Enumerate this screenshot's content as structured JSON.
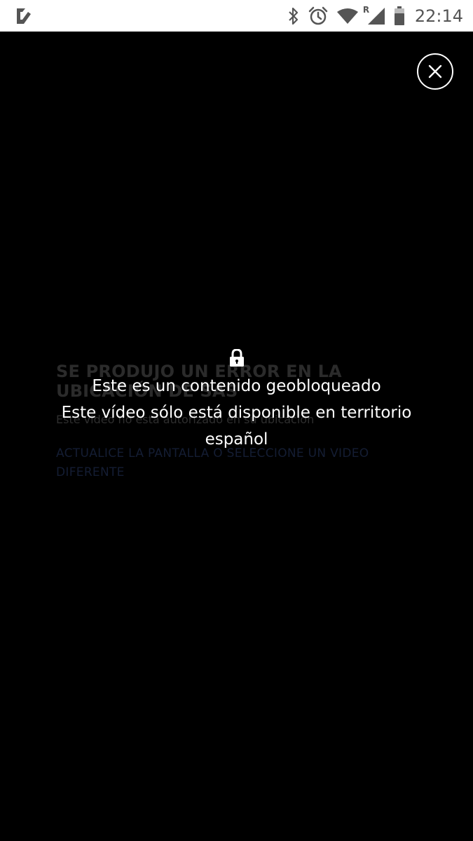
{
  "status_bar": {
    "time": "22:14",
    "icons": [
      "app-check-icon",
      "bluetooth-icon",
      "alarm-icon",
      "wifi-icon",
      "cellular-roaming-icon",
      "battery-icon"
    ],
    "roaming_marker": "R",
    "background": "#ffffff",
    "icon_color": "#555555"
  },
  "player": {
    "close_icon": "close-icon",
    "background": "#000000"
  },
  "error": {
    "title": "SE PRODUJO UN ERROR EN LA UBICACIÓN DE SAS",
    "description": "Este video no está autorizado en su ubicación",
    "action": "ACTUALICE LA PANTALLA O SELECCIONE UN VIDEO DIFERENTE"
  },
  "geoblock": {
    "icon": "lock-icon",
    "title": "Este es un contenido geobloqueado",
    "message": "Este vídeo sólo está disponible en territorio español",
    "text_color": "#ffffff"
  }
}
